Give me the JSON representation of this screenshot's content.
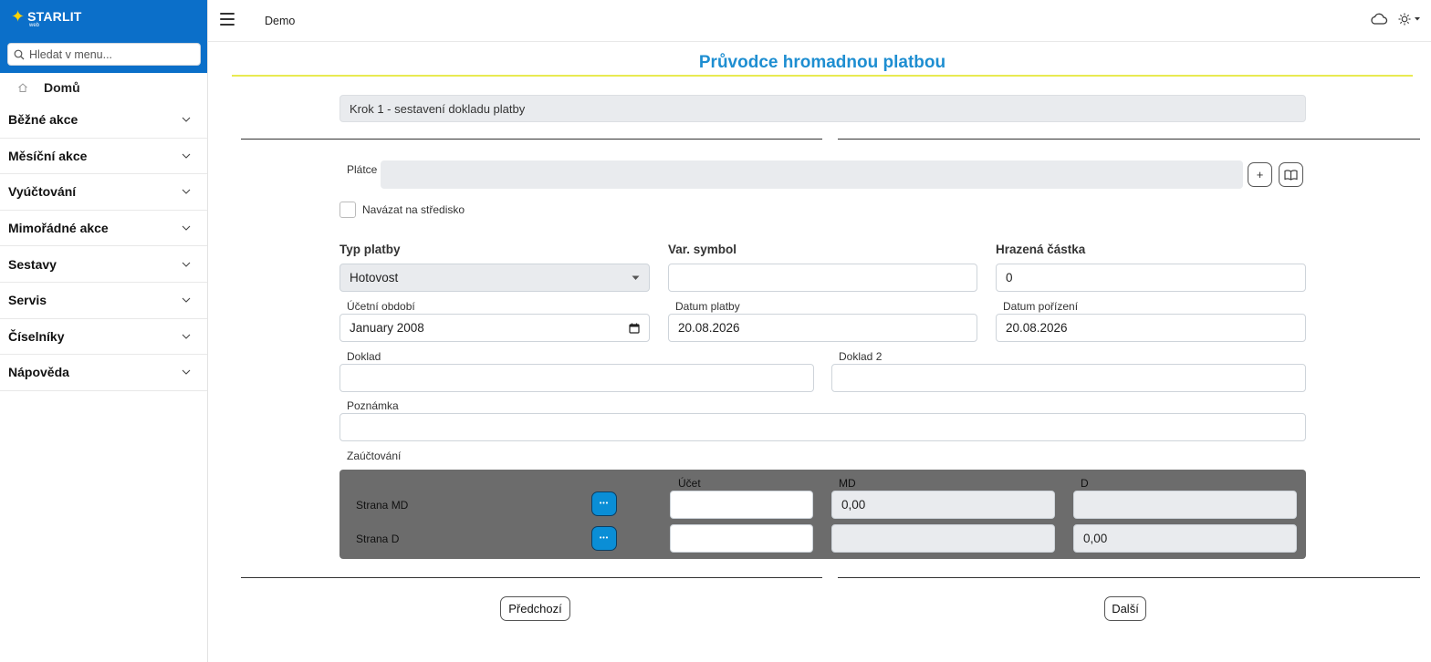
{
  "app": {
    "brand": "STARLIT",
    "brand_sub": "web",
    "colors": {
      "brand_blue": "#0b6fc9",
      "accent_yellow": "#ffd400",
      "title_blue": "#1e8ed1",
      "button_blue": "#0a8ed6"
    }
  },
  "sidebar": {
    "search_placeholder": "Hledat v menu...",
    "home_label": "Domů",
    "items": [
      {
        "label": "Běžné akce"
      },
      {
        "label": "Měsíční akce"
      },
      {
        "label": "Vyúčtování"
      },
      {
        "label": "Mimořádné akce"
      },
      {
        "label": "Sestavy"
      },
      {
        "label": "Servis"
      },
      {
        "label": "Číselníky"
      },
      {
        "label": "Nápověda"
      }
    ]
  },
  "topbar": {
    "context": "Demo"
  },
  "page": {
    "title": "Průvodce hromadnou platbou",
    "step": "Krok 1 - sestavení dokladu platby"
  },
  "form": {
    "platce_label": "Plátce",
    "platce_value": "",
    "add_symbol": "+",
    "checkbox_label": "Navázat na středisko",
    "typ_platby_label": "Typ platby",
    "typ_platby_value": "Hotovost",
    "var_symbol_label": "Var. symbol",
    "var_symbol_value": "",
    "hrazena_castka_label": "Hrazená částka",
    "hrazena_castka_value": "0",
    "ucetni_obdobi_label": "Účetní období",
    "ucetni_obdobi_value": "January 2008",
    "datum_platby_label": "Datum platby",
    "datum_platby_value": "20.08.2026",
    "datum_porizeni_label": "Datum pořízení",
    "datum_porizeni_value": "20.08.2026",
    "doklad_label": "Doklad",
    "doklad_value": "",
    "doklad2_label": "Doklad 2",
    "doklad2_value": "",
    "poznamka_label": "Poznámka",
    "poznamka_value": "",
    "zauctovani_label": "Zaúčtování"
  },
  "posting": {
    "headers": {
      "ucet": "Účet",
      "md": "MD",
      "d": "D"
    },
    "dots": "•••",
    "rows": [
      {
        "label": "Strana MD",
        "ucet": "",
        "md": "0,00",
        "d": ""
      },
      {
        "label": "Strana D",
        "ucet": "",
        "md": "",
        "d": "0,00"
      }
    ]
  },
  "nav": {
    "prev": "Předchozí",
    "next": "Další"
  }
}
